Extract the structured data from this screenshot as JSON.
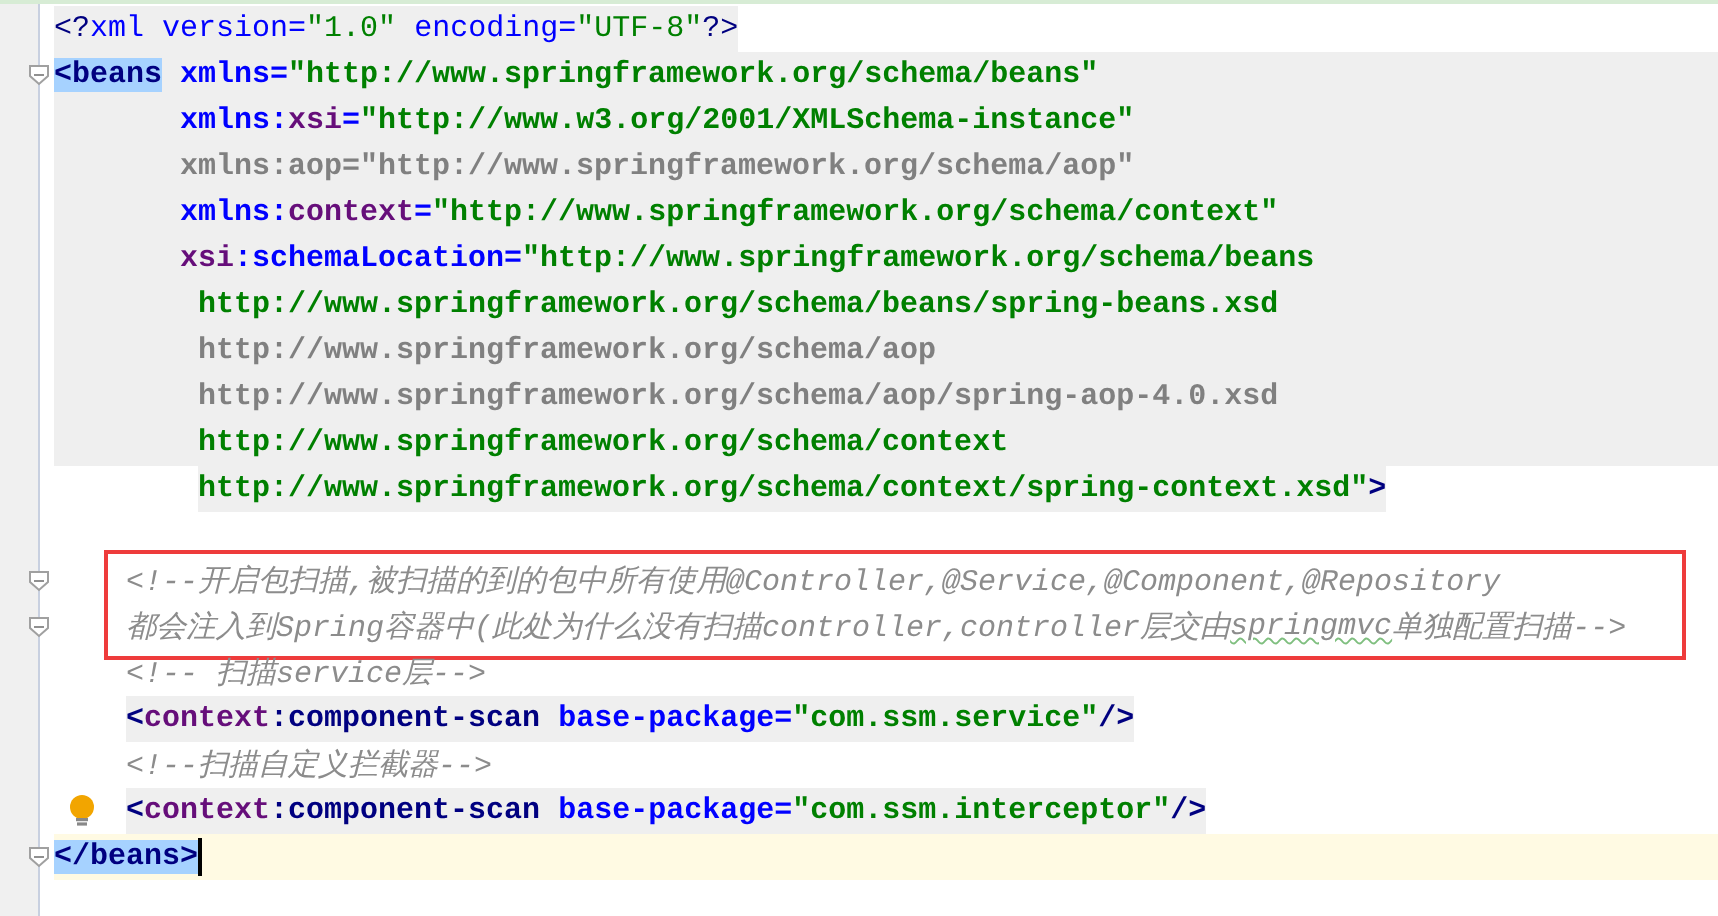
{
  "editor": {
    "lines": [
      {
        "kind": "decl",
        "shaded": true,
        "tokens": [
          {
            "text": "<?",
            "kind": "punct"
          },
          {
            "text": "xml version=",
            "kind": "attr_plain"
          },
          {
            "text": "\"1.0\"",
            "kind": "value_plain"
          },
          {
            "text": " encoding=",
            "kind": "attr_plain"
          },
          {
            "text": "\"UTF-8\"",
            "kind": "value_plain"
          },
          {
            "text": "?>",
            "kind": "punct"
          }
        ]
      },
      {
        "kind": "open",
        "shaded": true,
        "shade_full": true,
        "fold_marker": true,
        "tokens": [
          {
            "text": "<beans",
            "kind": "tag",
            "matched": true
          },
          {
            "text": " xmlns=",
            "kind": "attr"
          },
          {
            "text": "\"http://www.springframework.org/schema/beans\"",
            "kind": "value"
          }
        ]
      },
      {
        "kind": "attr",
        "shaded": true,
        "shade_full": true,
        "tokens": [
          {
            "text": "xmlns:",
            "kind": "attr"
          },
          {
            "text": "xsi",
            "kind": "ns"
          },
          {
            "text": "=",
            "kind": "attr"
          },
          {
            "text": "\"http://www.w3.org/2001/XMLSchema-instance\"",
            "kind": "value"
          }
        ]
      },
      {
        "kind": "attr",
        "shaded": true,
        "shade_full": true,
        "tokens": [
          {
            "text": "xmlns:aop=\"http://www.springframework.org/schema/aop\"",
            "kind": "unused"
          }
        ]
      },
      {
        "kind": "attr",
        "shaded": true,
        "shade_full": true,
        "tokens": [
          {
            "text": "xmlns:",
            "kind": "attr"
          },
          {
            "text": "context",
            "kind": "ns"
          },
          {
            "text": "=",
            "kind": "attr"
          },
          {
            "text": "\"http://www.springframework.org/schema/context\"",
            "kind": "value"
          }
        ]
      },
      {
        "kind": "attr",
        "shaded": true,
        "shade_full": true,
        "tokens": [
          {
            "text": "xsi",
            "kind": "ns"
          },
          {
            "text": ":schemaLocation=",
            "kind": "attr"
          },
          {
            "text": "\"http://www.springframework.org/schema/beans",
            "kind": "value"
          }
        ]
      },
      {
        "kind": "url",
        "shaded": true,
        "shade_full": true,
        "tokens": [
          {
            "text": "http://www.springframework.org/schema/beans/spring-beans.xsd",
            "kind": "value"
          }
        ]
      },
      {
        "kind": "url",
        "shaded": true,
        "shade_full": true,
        "tokens": [
          {
            "text": "http://www.springframework.org/schema/aop",
            "kind": "unused"
          }
        ]
      },
      {
        "kind": "url",
        "shaded": true,
        "shade_full": true,
        "tokens": [
          {
            "text": "http://www.springframework.org/schema/aop/spring-aop-4.0.xsd",
            "kind": "unused"
          }
        ]
      },
      {
        "kind": "url",
        "shaded": true,
        "shade_full": true,
        "tokens": [
          {
            "text": "http://www.springframework.org/schema/context",
            "kind": "value"
          }
        ]
      },
      {
        "kind": "url",
        "shaded": true,
        "tokens": [
          {
            "text": "http://www.springframework.org/schema/context/spring-context.xsd\"",
            "kind": "value"
          },
          {
            "text": ">",
            "kind": "tag"
          }
        ]
      },
      {
        "kind": "blank"
      },
      {
        "kind": "child",
        "shaded": false,
        "fold_marker": true,
        "boxed": true,
        "tokens": [
          {
            "text": "<!--开启包扫描,被扫描的到的包中所有使用@Controller,@Service,@Component,@Repository",
            "kind": "comment"
          }
        ]
      },
      {
        "kind": "child",
        "shaded": false,
        "fold_marker": true,
        "boxed": true,
        "tokens": [
          {
            "text": "都会注入到Spring容器中(此处为什么没有扫描controller,controller层交由",
            "kind": "comment"
          },
          {
            "text": "springmvc",
            "kind": "comment",
            "typo": true
          },
          {
            "text": "单独配置扫描-->",
            "kind": "comment"
          }
        ]
      },
      {
        "kind": "child",
        "shaded": false,
        "tokens": [
          {
            "text": "<!-- 扫描service层-->",
            "kind": "comment"
          }
        ]
      },
      {
        "kind": "child",
        "shaded": true,
        "tokens": [
          {
            "text": "<",
            "kind": "tag"
          },
          {
            "text": "context",
            "kind": "ns"
          },
          {
            "text": ":component-scan",
            "kind": "tag"
          },
          {
            "text": " base-package=",
            "kind": "attr"
          },
          {
            "text": "\"com.ssm.service\"",
            "kind": "value"
          },
          {
            "text": "/>",
            "kind": "tag"
          }
        ]
      },
      {
        "kind": "child",
        "shaded": false,
        "tokens": [
          {
            "text": "<!--扫描自定义拦截器-->",
            "kind": "comment"
          }
        ]
      },
      {
        "kind": "child",
        "shaded": true,
        "bulb": true,
        "tokens": [
          {
            "text": "<",
            "kind": "tag"
          },
          {
            "text": "context",
            "kind": "ns"
          },
          {
            "text": ":component-scan",
            "kind": "tag"
          },
          {
            "text": " base-package=",
            "kind": "attr"
          },
          {
            "text": "\"com.ssm.interceptor\"",
            "kind": "value"
          },
          {
            "text": "/>",
            "kind": "tag"
          }
        ]
      },
      {
        "kind": "close",
        "shaded": false,
        "fold_marker": true,
        "current": true,
        "caret": true,
        "tokens": [
          {
            "text": "</beans>",
            "kind": "tag",
            "matched": true
          }
        ]
      }
    ]
  }
}
